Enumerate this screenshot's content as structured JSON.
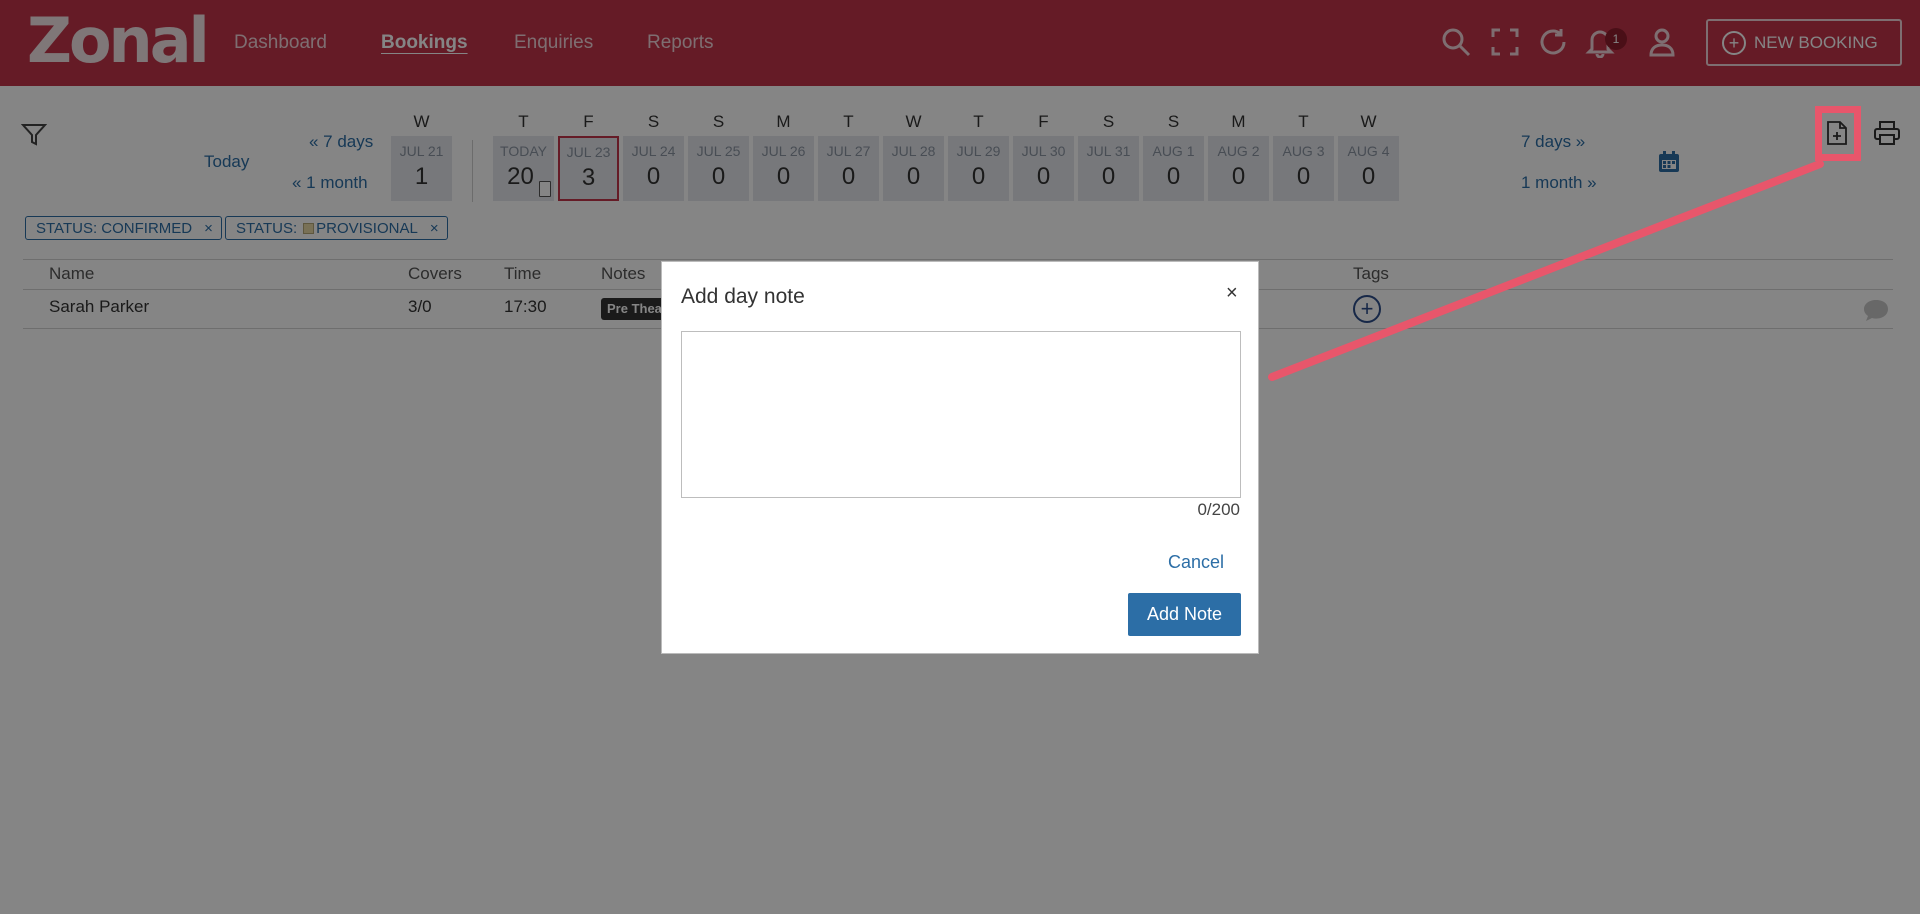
{
  "header": {
    "logo": "Zonal",
    "nav": [
      "Dashboard",
      "Bookings",
      "Enquiries",
      "Reports"
    ],
    "notification_count": "1",
    "new_booking_label": "NEW BOOKING"
  },
  "date_nav": {
    "today": "Today",
    "back_7": "« 7 days",
    "back_month": "« 1 month",
    "fwd_7": "7 days »",
    "fwd_month": "1 month »"
  },
  "days": [
    {
      "dow": "W",
      "label": "JUL 21",
      "count": "1"
    },
    {
      "dow": "T",
      "label": "TODAY",
      "count": "20"
    },
    {
      "dow": "F",
      "label": "JUL 23",
      "count": "3"
    },
    {
      "dow": "S",
      "label": "JUL 24",
      "count": "0"
    },
    {
      "dow": "S",
      "label": "JUL 25",
      "count": "0"
    },
    {
      "dow": "M",
      "label": "JUL 26",
      "count": "0"
    },
    {
      "dow": "T",
      "label": "JUL 27",
      "count": "0"
    },
    {
      "dow": "W",
      "label": "JUL 28",
      "count": "0"
    },
    {
      "dow": "T",
      "label": "JUL 29",
      "count": "0"
    },
    {
      "dow": "F",
      "label": "JUL 30",
      "count": "0"
    },
    {
      "dow": "S",
      "label": "JUL 31",
      "count": "0"
    },
    {
      "dow": "S",
      "label": "AUG 1",
      "count": "0"
    },
    {
      "dow": "M",
      "label": "AUG 2",
      "count": "0"
    },
    {
      "dow": "T",
      "label": "AUG 3",
      "count": "0"
    },
    {
      "dow": "W",
      "label": "AUG 4",
      "count": "0"
    }
  ],
  "filters": [
    {
      "label": "STATUS: CONFIRMED",
      "remove": "×"
    },
    {
      "label_prefix": "STATUS:",
      "label": "PROVISIONAL",
      "remove": "×"
    }
  ],
  "table": {
    "headers": [
      "Name",
      "Covers",
      "Time",
      "Notes",
      "Tags"
    ],
    "rows": [
      {
        "name": "Sarah Parker",
        "covers": "3/0",
        "time": "17:30",
        "note": "Pre Thea"
      }
    ]
  },
  "modal": {
    "title": "Add day note",
    "close": "×",
    "textarea_value": "",
    "counter": "0/200",
    "cancel": "Cancel",
    "submit": "Add Note"
  },
  "colors": {
    "brand": "#c2344a",
    "link": "#2c6ea6",
    "annotation": "#e8566b"
  }
}
